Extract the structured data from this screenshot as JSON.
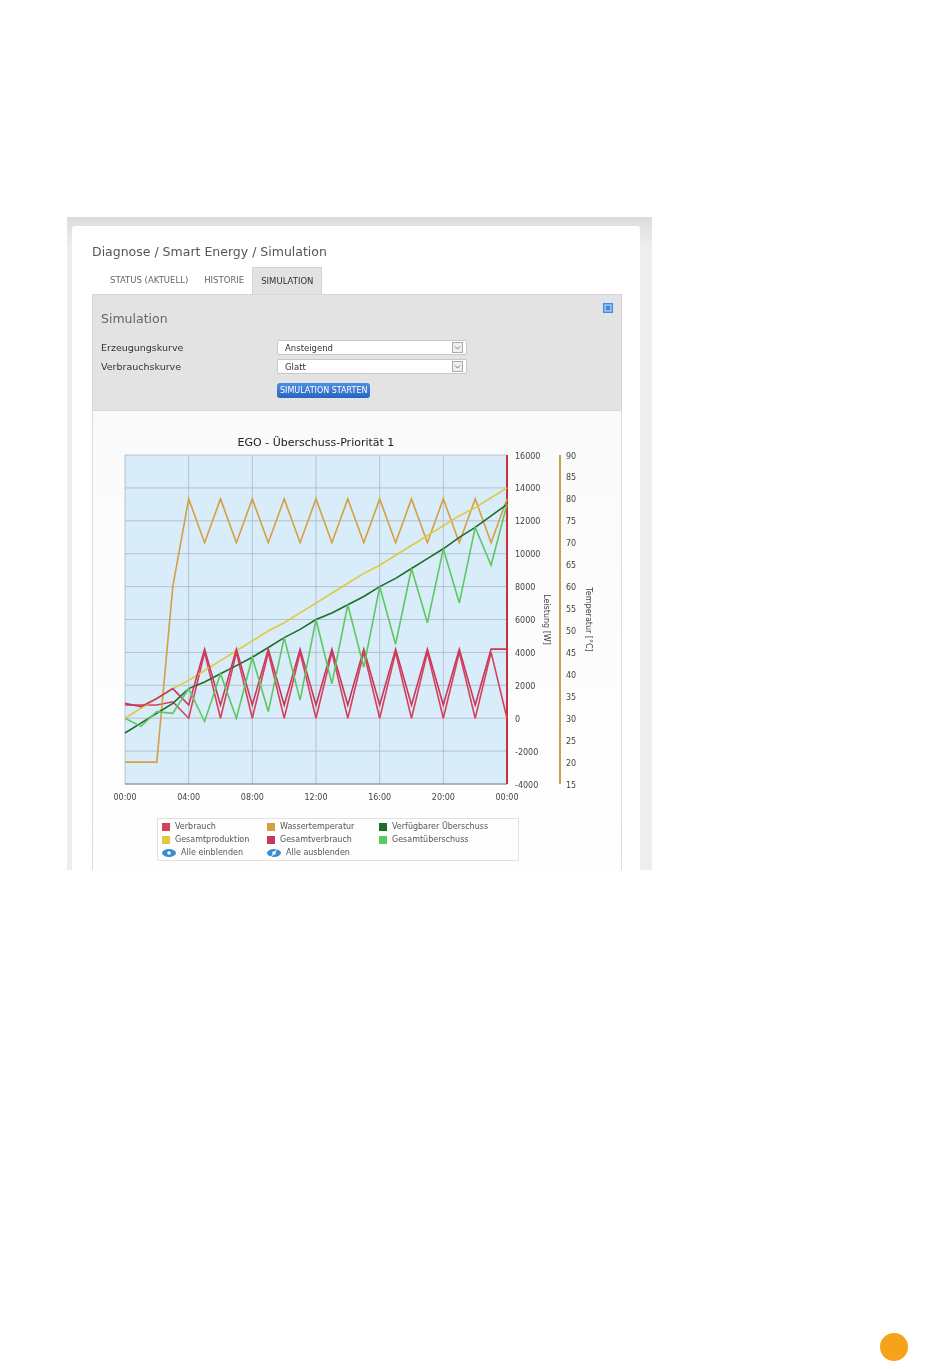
{
  "breadcrumb": "Diagnose / Smart Energy / Simulation",
  "tabs": [
    {
      "label": "STATUS (AKTUELL)",
      "selected": false
    },
    {
      "label": "HISTORIE",
      "selected": false
    },
    {
      "label": "SIMULATION",
      "selected": true
    }
  ],
  "simulation": {
    "heading": "Simulation",
    "fields": [
      {
        "label": "Erzeugungskurve",
        "value": "Ansteigend"
      },
      {
        "label": "Verbrauchskurve",
        "value": "Glatt"
      }
    ],
    "button": "SIMULATION STARTEN"
  },
  "chart": {
    "chart_data": {
      "type": "line",
      "title": "EGO - Überschuss-Priorität 1",
      "ylabel": "Leistung [W]",
      "y2label": "Temperatur [°C]",
      "x": [
        0,
        1,
        2,
        3,
        4,
        5,
        6,
        7,
        8,
        9,
        10,
        11,
        12,
        13,
        14,
        15,
        16,
        17,
        18,
        19,
        20,
        21,
        22,
        23,
        24
      ],
      "grid": true,
      "xlim": [
        0,
        24
      ],
      "ylim": [
        -4000,
        16000
      ],
      "y2lim": [
        15,
        90
      ],
      "xticks": [
        {
          "value": 0,
          "label": "00:00"
        },
        {
          "value": 4,
          "label": "04:00"
        },
        {
          "value": 8,
          "label": "08:00"
        },
        {
          "value": 12,
          "label": "12:00"
        },
        {
          "value": 16,
          "label": "16:00"
        },
        {
          "value": 20,
          "label": "20:00"
        },
        {
          "value": 24,
          "label": "00:00"
        }
      ],
      "yticks": [
        -4000,
        -2000,
        0,
        2000,
        4000,
        6000,
        8000,
        10000,
        12000,
        14000,
        16000
      ],
      "y2ticks": [
        15,
        20,
        25,
        30,
        35,
        40,
        45,
        50,
        55,
        60,
        65,
        70,
        75,
        80,
        85,
        90
      ],
      "series": [
        {
          "name": "Verbrauch",
          "color": "#d6405a",
          "values": [
            800,
            800,
            800,
            1000,
            0,
            4000,
            0,
            4000,
            0,
            4000,
            0,
            4000,
            0,
            4000,
            0,
            4000,
            0,
            4000,
            0,
            4000,
            0,
            4000,
            0,
            4000,
            0
          ]
        },
        {
          "name": "Wassertemperatur",
          "color": "#d4a040",
          "axis": "y2",
          "values": [
            20,
            20,
            20,
            60,
            80,
            70,
            80,
            70,
            80,
            70,
            80,
            70,
            80,
            70,
            80,
            70,
            80,
            70,
            80,
            70,
            80,
            70,
            80,
            70,
            80
          ]
        },
        {
          "name": "Verfügbarer Überschuss",
          "color": "#1e6b2a",
          "values": [
            -900,
            -300,
            300,
            900,
            1800,
            2200,
            2700,
            3200,
            3700,
            4300,
            4900,
            5400,
            6000,
            6400,
            6900,
            7400,
            8000,
            8500,
            9100,
            9700,
            10300,
            11000,
            11600,
            12300,
            13000
          ]
        },
        {
          "name": "Gesamtproduktion",
          "color": "#e0c840",
          "values": [
            0,
            600,
            1200,
            1800,
            2300,
            2900,
            3500,
            4100,
            4700,
            5300,
            5800,
            6400,
            7000,
            7600,
            8200,
            8800,
            9300,
            9900,
            10500,
            11100,
            11700,
            12300,
            12800,
            13400,
            14000
          ]
        },
        {
          "name": "Gesamtverbrauch",
          "color": "#c8385a",
          "values": [
            900,
            700,
            1200,
            1800,
            800,
            4200,
            800,
            4200,
            800,
            4200,
            800,
            4200,
            800,
            4200,
            800,
            4200,
            800,
            4200,
            800,
            4200,
            800,
            4200,
            800,
            4200,
            4200
          ]
        },
        {
          "name": "Gesamtüberschuss",
          "color": "#5cc860",
          "values": [
            0,
            -500,
            400,
            300,
            1800,
            -200,
            2700,
            0,
            3700,
            400,
            4900,
            1100,
            6000,
            2100,
            6900,
            3100,
            8000,
            4500,
            9100,
            5800,
            10300,
            7000,
            11600,
            9300,
            13000
          ]
        }
      ]
    },
    "legend_actions": [
      {
        "kind": "show",
        "label": "Alle einblenden"
      },
      {
        "kind": "hide",
        "label": "Alle ausblenden"
      }
    ]
  }
}
